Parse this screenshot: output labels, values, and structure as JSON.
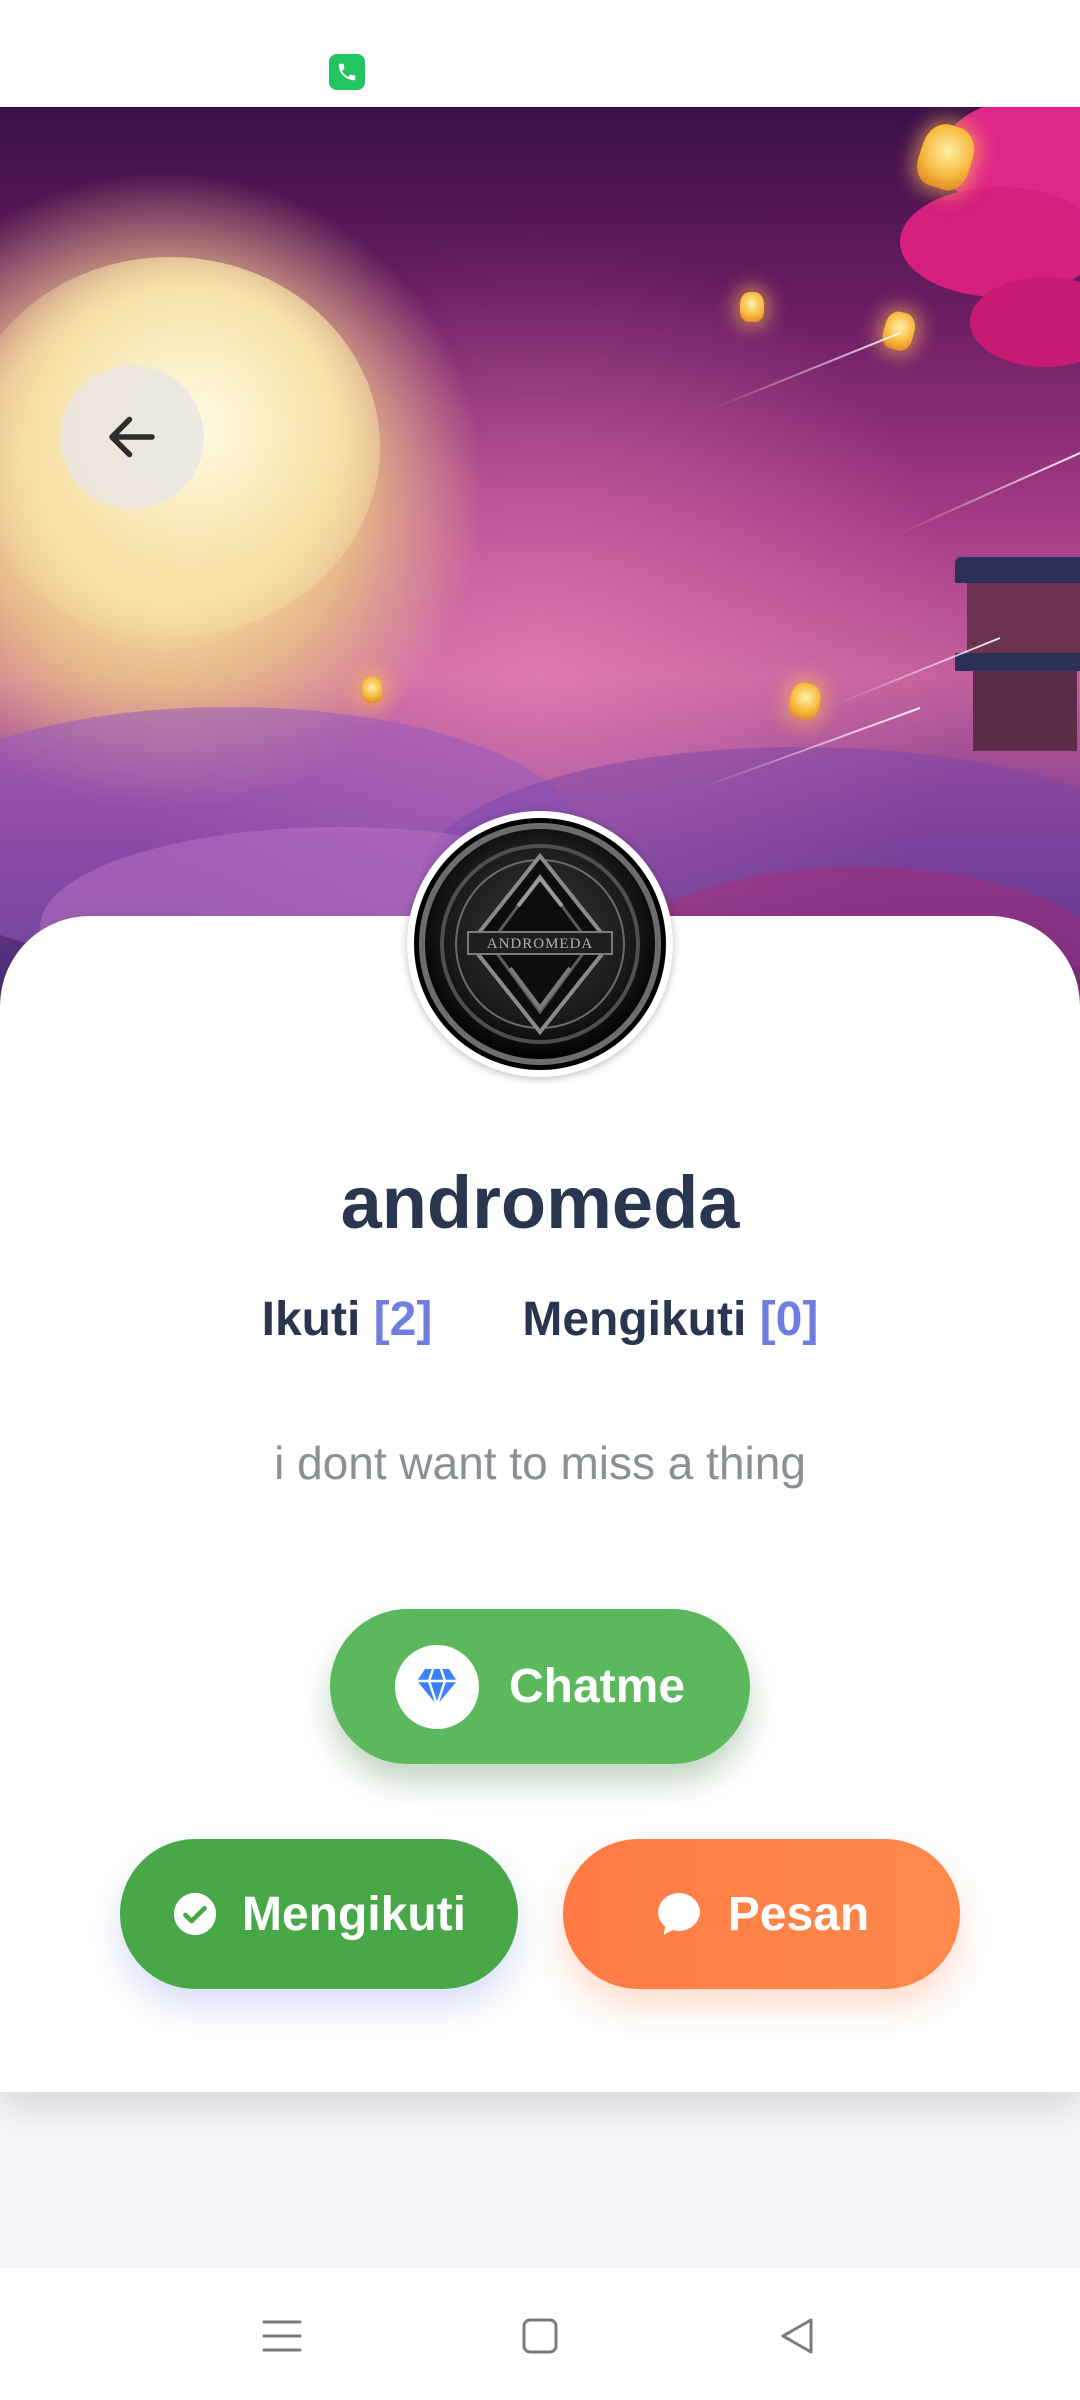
{
  "profile": {
    "username": "andromeda",
    "avatar_text": "ANDROMEDA",
    "bio": "i dont want to miss a thing",
    "stats": {
      "follow_label": "Ikuti",
      "follow_count": "[2]",
      "following_label": "Mengikuti",
      "following_count": "[0]"
    }
  },
  "actions": {
    "chatme_label": "Chatme",
    "following_label": "Mengikuti",
    "message_label": "Pesan"
  },
  "icons": {
    "status": "phone-call-icon",
    "back": "arrow-left-icon",
    "chatme": "diamond-icon",
    "following": "check-circle-icon",
    "message": "chat-bubble-icon",
    "nav": [
      "menu-icon",
      "home-square-icon",
      "back-triangle-icon"
    ]
  },
  "colors": {
    "chatme": "#5cb85c",
    "following": "#48a848",
    "message": "#ff7a45",
    "stat_number": "#6f7ee0",
    "title": "#2a3650"
  }
}
